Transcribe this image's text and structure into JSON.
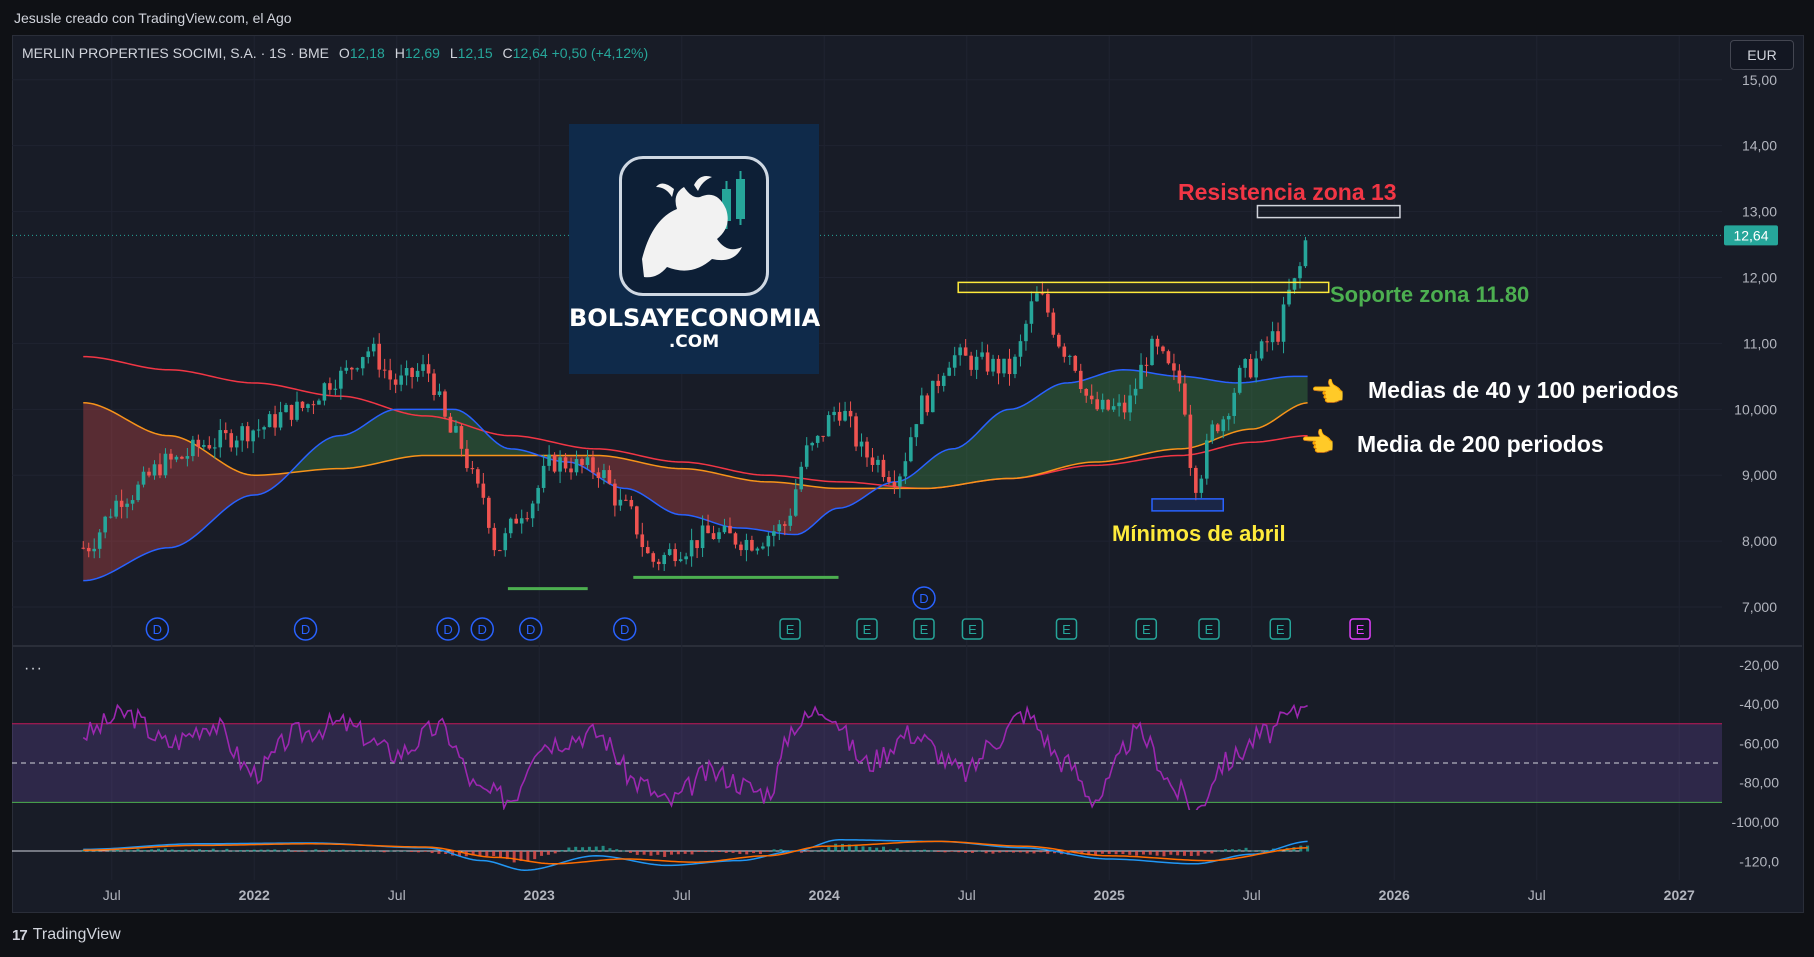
{
  "credit": "Jesusle creado con TradingView.com, el Ago",
  "symbol": {
    "name": "MERLIN PROPERTIES SOCIMI, S.A. · 1S · BME",
    "o_label": "O",
    "o": "12,18",
    "h_label": "H",
    "h": "12,69",
    "l_label": "L",
    "l": "12,15",
    "c_label": "C",
    "c": "12,64",
    "change": "+0,50 (+4,12%)"
  },
  "currency": "EUR",
  "footer": {
    "brand": "TradingView",
    "mark": "17"
  },
  "logo": {
    "name": "BOLSAYECONOMIA",
    "domain": ".COM"
  },
  "indicator_menu": "···",
  "colors": {
    "bg": "#181c27",
    "up": "#26a69a",
    "down": "#ef5350",
    "ma40": "#2962ff",
    "ma100": "#f7931a",
    "ma200": "#f23645",
    "rsi": "#9c27b0",
    "annot_red": "#f23645",
    "annot_green": "#4caf50",
    "annot_yellow": "#ffeb3b",
    "annot_white": "#ffffff"
  },
  "chart_data": [
    {
      "type": "candlestick",
      "title": "",
      "x_ticks": [
        "Jul",
        "2022",
        "Jul",
        "2023",
        "Jul",
        "2024",
        "Jul",
        "2025",
        "Jul",
        "2026",
        "Jul",
        "2027"
      ],
      "y_ticks": [
        "15,00",
        "14,00",
        "13,00",
        "12,00",
        "11,00",
        "10,000",
        "9,000",
        "8,000",
        "7,000"
      ],
      "ylim": [
        6.5,
        15.3
      ],
      "last_price": "12,64",
      "close_anchors": [
        [
          2021.4,
          7.9
        ],
        [
          2021.55,
          8.7
        ],
        [
          2021.7,
          9.2
        ],
        [
          2021.85,
          9.5
        ],
        [
          2022.0,
          9.7
        ],
        [
          2022.15,
          10.0
        ],
        [
          2022.3,
          10.5
        ],
        [
          2022.4,
          10.9
        ],
        [
          2022.5,
          10.4
        ],
        [
          2022.6,
          10.6
        ],
        [
          2022.7,
          9.6
        ],
        [
          2022.8,
          8.7
        ],
        [
          2022.85,
          7.9
        ],
        [
          2022.95,
          8.5
        ],
        [
          2023.05,
          9.2
        ],
        [
          2023.2,
          9.1
        ],
        [
          2023.3,
          8.5
        ],
        [
          2023.4,
          7.7
        ],
        [
          2023.5,
          7.9
        ],
        [
          2023.6,
          8.1
        ],
        [
          2023.75,
          8.0
        ],
        [
          2023.85,
          8.2
        ],
        [
          2023.95,
          9.4
        ],
        [
          2024.05,
          10.0
        ],
        [
          2024.15,
          9.3
        ],
        [
          2024.25,
          9.0
        ],
        [
          2024.35,
          10.1
        ],
        [
          2024.45,
          10.8
        ],
        [
          2024.55,
          10.7
        ],
        [
          2024.65,
          10.6
        ],
        [
          2024.75,
          11.7
        ],
        [
          2024.85,
          10.9
        ],
        [
          2024.95,
          10.0
        ],
        [
          2025.05,
          10.0
        ],
        [
          2025.15,
          10.9
        ],
        [
          2025.25,
          10.4
        ],
        [
          2025.3,
          8.9
        ],
        [
          2025.38,
          9.8
        ],
        [
          2025.48,
          10.6
        ],
        [
          2025.58,
          11.1
        ],
        [
          2025.65,
          11.9
        ],
        [
          2025.7,
          12.64
        ]
      ],
      "ma40_anchors": [
        [
          2021.4,
          7.4
        ],
        [
          2021.7,
          7.9
        ],
        [
          2022.0,
          8.7
        ],
        [
          2022.3,
          9.6
        ],
        [
          2022.5,
          10.0
        ],
        [
          2022.7,
          10.0
        ],
        [
          2022.9,
          9.4
        ],
        [
          2023.1,
          9.2
        ],
        [
          2023.3,
          8.8
        ],
        [
          2023.5,
          8.4
        ],
        [
          2023.7,
          8.2
        ],
        [
          2023.9,
          8.1
        ],
        [
          2024.05,
          8.5
        ],
        [
          2024.25,
          8.9
        ],
        [
          2024.45,
          9.4
        ],
        [
          2024.65,
          10.0
        ],
        [
          2024.85,
          10.4
        ],
        [
          2025.05,
          10.6
        ],
        [
          2025.25,
          10.5
        ],
        [
          2025.45,
          10.4
        ],
        [
          2025.65,
          10.5
        ]
      ],
      "ma100_anchors": [
        [
          2021.4,
          10.1
        ],
        [
          2021.7,
          9.6
        ],
        [
          2022.0,
          9.0
        ],
        [
          2022.3,
          9.1
        ],
        [
          2022.6,
          9.3
        ],
        [
          2022.9,
          9.3
        ],
        [
          2023.2,
          9.3
        ],
        [
          2023.5,
          9.1
        ],
        [
          2023.8,
          8.9
        ],
        [
          2024.05,
          8.8
        ],
        [
          2024.35,
          8.8
        ],
        [
          2024.65,
          8.95
        ],
        [
          2024.95,
          9.2
        ],
        [
          2025.25,
          9.4
        ],
        [
          2025.5,
          9.7
        ],
        [
          2025.7,
          10.1
        ]
      ],
      "ma200_anchors": [
        [
          2021.4,
          10.8
        ],
        [
          2021.7,
          10.6
        ],
        [
          2022.0,
          10.4
        ],
        [
          2022.3,
          10.2
        ],
        [
          2022.6,
          9.9
        ],
        [
          2022.9,
          9.6
        ],
        [
          2023.2,
          9.4
        ],
        [
          2023.5,
          9.2
        ],
        [
          2023.8,
          9.0
        ],
        [
          2024.05,
          8.9
        ],
        [
          2024.35,
          8.8
        ],
        [
          2024.65,
          8.95
        ],
        [
          2024.95,
          9.15
        ],
        [
          2025.25,
          9.3
        ],
        [
          2025.5,
          9.5
        ],
        [
          2025.7,
          9.6
        ]
      ],
      "event_markers": [
        {
          "label": "D",
          "x": 2021.66
        },
        {
          "label": "D",
          "x": 2022.18
        },
        {
          "label": "D",
          "x": 2022.68
        },
        {
          "label": "D",
          "x": 2022.8
        },
        {
          "label": "D",
          "x": 2022.97
        },
        {
          "label": "D",
          "x": 2023.3
        },
        {
          "label": "D",
          "x": 2024.35,
          "row": "upper"
        },
        {
          "label": "E",
          "x": 2023.88
        },
        {
          "label": "E",
          "x": 2024.15
        },
        {
          "label": "E",
          "x": 2024.35
        },
        {
          "label": "E",
          "x": 2024.52
        },
        {
          "label": "E",
          "x": 2024.85
        },
        {
          "label": "E",
          "x": 2025.13
        },
        {
          "label": "E",
          "x": 2025.35
        },
        {
          "label": "E",
          "x": 2025.6
        },
        {
          "label": "E",
          "x": 2025.88,
          "accent": "magenta"
        }
      ]
    },
    {
      "type": "line",
      "title": "",
      "y_ticks": [
        "-20,00",
        "-40,00",
        "-60,00",
        "-80,00",
        "-100,00",
        "-120,0"
      ],
      "ylim": [
        -127,
        -15
      ],
      "band": [
        -90,
        -50
      ],
      "midline": -70,
      "anchors": [
        [
          2021.4,
          -55
        ],
        [
          2021.55,
          -45
        ],
        [
          2021.7,
          -60
        ],
        [
          2021.85,
          -50
        ],
        [
          2022.0,
          -75
        ],
        [
          2022.15,
          -55
        ],
        [
          2022.3,
          -50
        ],
        [
          2022.5,
          -65
        ],
        [
          2022.65,
          -52
        ],
        [
          2022.8,
          -85
        ],
        [
          2022.9,
          -88
        ],
        [
          2023.0,
          -60
        ],
        [
          2023.2,
          -55
        ],
        [
          2023.35,
          -80
        ],
        [
          2023.45,
          -90
        ],
        [
          2023.6,
          -75
        ],
        [
          2023.8,
          -85
        ],
        [
          2023.9,
          -50
        ],
        [
          2024.0,
          -42
        ],
        [
          2024.15,
          -70
        ],
        [
          2024.3,
          -55
        ],
        [
          2024.5,
          -75
        ],
        [
          2024.6,
          -58
        ],
        [
          2024.7,
          -45
        ],
        [
          2024.85,
          -70
        ],
        [
          2024.95,
          -88
        ],
        [
          2025.1,
          -55
        ],
        [
          2025.25,
          -85
        ],
        [
          2025.3,
          -95
        ],
        [
          2025.4,
          -70
        ],
        [
          2025.55,
          -55
        ],
        [
          2025.65,
          -45
        ],
        [
          2025.7,
          -35
        ]
      ]
    },
    {
      "type": "line",
      "title": "",
      "ylim": [
        -1.5,
        1.5
      ],
      "macd_anchors": [
        [
          2021.4,
          0.1
        ],
        [
          2021.8,
          0.45
        ],
        [
          2022.2,
          0.5
        ],
        [
          2022.6,
          0.2
        ],
        [
          2022.8,
          -0.6
        ],
        [
          2022.95,
          -1.2
        ],
        [
          2023.2,
          -0.3
        ],
        [
          2023.45,
          -0.9
        ],
        [
          2023.7,
          -0.6
        ],
        [
          2023.9,
          0.0
        ],
        [
          2024.05,
          0.7
        ],
        [
          2024.4,
          0.6
        ],
        [
          2024.7,
          0.2
        ],
        [
          2025.0,
          -0.5
        ],
        [
          2025.3,
          -0.8
        ],
        [
          2025.5,
          -0.2
        ],
        [
          2025.7,
          0.6
        ]
      ],
      "signal_anchors": [
        [
          2021.4,
          0.05
        ],
        [
          2021.8,
          0.35
        ],
        [
          2022.2,
          0.45
        ],
        [
          2022.6,
          0.25
        ],
        [
          2022.85,
          -0.4
        ],
        [
          2023.05,
          -0.8
        ],
        [
          2023.3,
          -0.5
        ],
        [
          2023.55,
          -0.7
        ],
        [
          2023.8,
          -0.3
        ],
        [
          2024.0,
          0.3
        ],
        [
          2024.4,
          0.6
        ],
        [
          2024.7,
          0.3
        ],
        [
          2025.0,
          -0.3
        ],
        [
          2025.35,
          -0.6
        ],
        [
          2025.7,
          0.2
        ]
      ]
    }
  ],
  "annotations": {
    "resistance": "Resistencia zona 13",
    "support": "Soporte zona 11.80",
    "ma_40_100": "Medias de 40 y 100 periodos",
    "ma_200": "Media de 200 periodos",
    "april_lows": "Mínimos de abril",
    "pointer": "👈"
  }
}
